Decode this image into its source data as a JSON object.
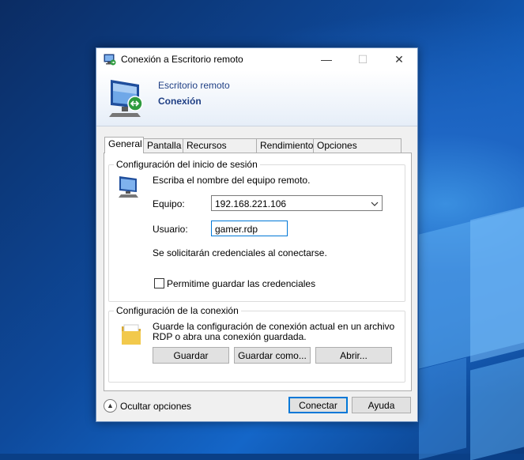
{
  "window": {
    "title": "Conexión a Escritorio remoto",
    "minimize_glyph": "—",
    "maximize_glyph": "☐",
    "close_glyph": "✕"
  },
  "banner": {
    "line1": "Escritorio remoto",
    "line2": "Conexión"
  },
  "tabs": [
    {
      "label": "General",
      "active": true
    },
    {
      "label": "Pantalla",
      "active": false
    },
    {
      "label": "Recursos locales",
      "active": false
    },
    {
      "label": "Rendimiento",
      "active": false
    },
    {
      "label": "Opciones avanzadas",
      "active": false
    }
  ],
  "login_group": {
    "legend": "Configuración del inicio de sesión",
    "instruction": "Escriba el nombre del equipo remoto.",
    "computer_label": "Equipo:",
    "computer_value": "192.168.221.106",
    "user_label": "Usuario:",
    "user_value": "gamer.rdp",
    "credentials_note": "Se solicitarán credenciales al conectarse.",
    "save_credentials_label": "Permitime guardar las credenciales",
    "save_credentials_checked": false
  },
  "connection_group": {
    "legend": "Configuración de la conexión",
    "description_line1": "Guarde la configuración de conexión actual en un archivo",
    "description_line2": "RDP o abra una conexión guardada.",
    "save_label": "Guardar",
    "save_as_label": "Guardar como...",
    "open_label": "Abrir..."
  },
  "footer": {
    "hide_options_label": "Ocultar opciones",
    "connect_label": "Conectar",
    "help_label": "Ayuda"
  },
  "icons": {
    "title": "remote-desktop-icon",
    "banner": "remote-desktop-monitor-icon",
    "computer": "computer-monitor-icon",
    "folder": "folder-icon",
    "collapse": "chevron-up-icon",
    "dropdown": "chevron-down-icon"
  },
  "colors": {
    "accent": "#0078d7",
    "banner_text": "#1f3f84"
  }
}
